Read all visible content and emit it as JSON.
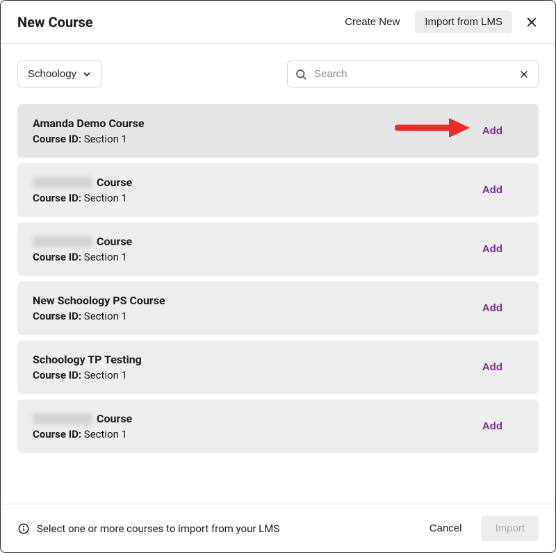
{
  "header": {
    "title": "New Course",
    "tabs": {
      "create_new": "Create New",
      "import_lms": "Import from LMS"
    }
  },
  "controls": {
    "dropdown_label": "Schoology",
    "search_placeholder": "Search",
    "search_value": ""
  },
  "courses": [
    {
      "name": "Amanda Demo Course",
      "name_suffix": "",
      "blurred": false,
      "course_id_label": "Course ID:",
      "course_id_value": "Section 1",
      "add_label": "Add",
      "highlight": true
    },
    {
      "name": "",
      "name_suffix": "Course",
      "blurred": true,
      "course_id_label": "Course ID:",
      "course_id_value": "Section 1",
      "add_label": "Add",
      "highlight": false
    },
    {
      "name": "",
      "name_suffix": "Course",
      "blurred": true,
      "course_id_label": "Course ID:",
      "course_id_value": "Section 1",
      "add_label": "Add",
      "highlight": false
    },
    {
      "name": "New Schoology PS Course",
      "name_suffix": "",
      "blurred": false,
      "course_id_label": "Course ID:",
      "course_id_value": "Section 1",
      "add_label": "Add",
      "highlight": false
    },
    {
      "name": "Schoology TP Testing",
      "name_suffix": "",
      "blurred": false,
      "course_id_label": "Course ID:",
      "course_id_value": "Section 1",
      "add_label": "Add",
      "highlight": false
    },
    {
      "name": "",
      "name_suffix": "Course",
      "blurred": true,
      "course_id_label": "Course ID:",
      "course_id_value": "Section 1",
      "add_label": "Add",
      "highlight": false
    }
  ],
  "footer": {
    "info_text": "Select one or more courses to import from your LMS",
    "cancel_label": "Cancel",
    "import_label": "Import"
  },
  "colors": {
    "accent": "#7b2e8e",
    "annotation_red": "#eb2a2a"
  }
}
